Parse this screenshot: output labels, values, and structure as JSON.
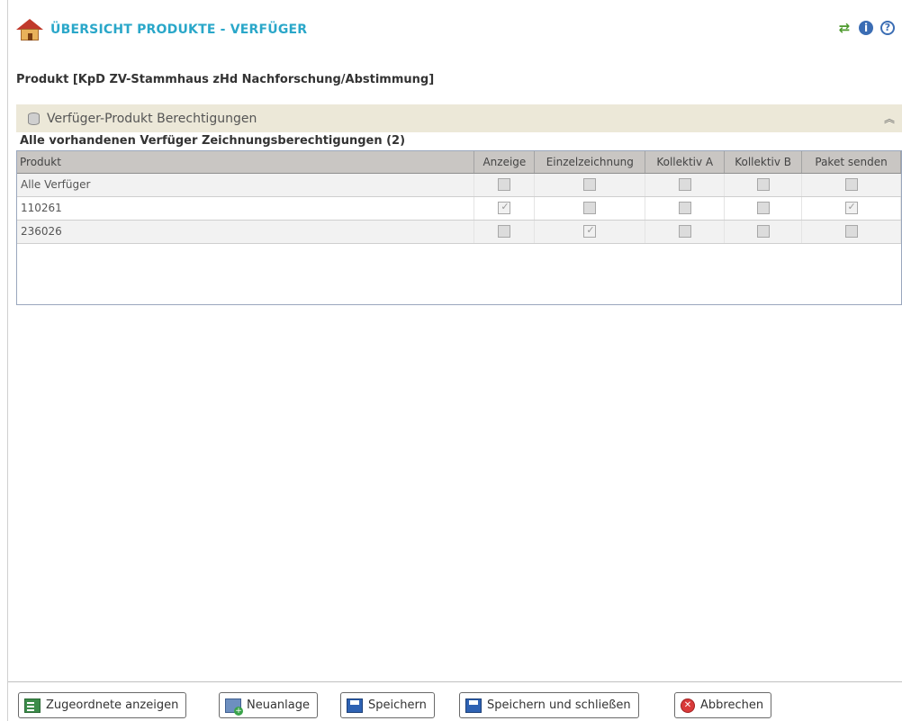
{
  "window": {
    "title": "ÜBERSICHT PRODUKTE - VERFÜGER",
    "icons": [
      "house-icon",
      "refresh-icon",
      "info-icon",
      "help-icon"
    ]
  },
  "product_heading": "Produkt [KpD ZV-Stammhaus zHd Nachforschung/Abstimmung]",
  "panel": {
    "title": "Verfüger-Produkt Berechtigungen",
    "subheading": "Alle vorhandenen Verfüger Zeichnungsberechtigungen (2)",
    "columns": [
      "Produkt",
      "Anzeige",
      "Einzelzeichnung",
      "Kollektiv A",
      "Kollektiv B",
      "Paket senden"
    ],
    "rows": [
      {
        "produkt": "Alle Verfüger",
        "anzeige": false,
        "einzelzeichnung": false,
        "kollektiv_a": false,
        "kollektiv_b": false,
        "paket_senden": false
      },
      {
        "produkt": "110261",
        "anzeige": true,
        "einzelzeichnung": false,
        "kollektiv_a": false,
        "kollektiv_b": false,
        "paket_senden": true
      },
      {
        "produkt": "236026",
        "anzeige": false,
        "einzelzeichnung": true,
        "kollektiv_a": false,
        "kollektiv_b": false,
        "paket_senden": false
      }
    ]
  },
  "footer": {
    "zugeordnete": "Zugeordnete anzeigen",
    "neuanlage": "Neuanlage",
    "speichern": "Speichern",
    "speichern_schliessen": "Speichern und schließen",
    "abbrechen": "Abbrechen"
  },
  "colors": {
    "title": "#2aa7c9",
    "panel_header": "#ece8d8",
    "grid_header": "#c9c6c3"
  }
}
